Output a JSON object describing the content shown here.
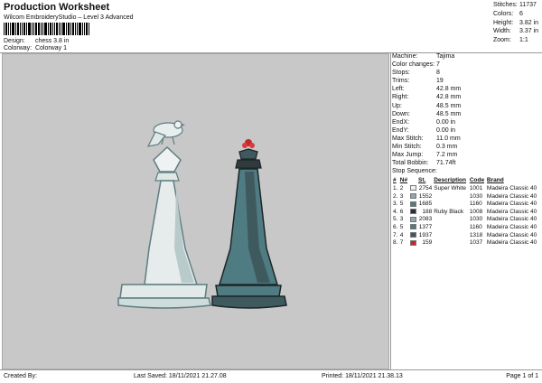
{
  "header": {
    "title": "Production Worksheet",
    "subtitle": "Wilcom EmbroideryStudio – Level 3 Advanced",
    "design_label": "Design:",
    "design_value": "chess 3.8 in",
    "colorway_label": "Colorway:",
    "colorway_value": "Colorway 1"
  },
  "summary": [
    {
      "label": "Stitches:",
      "value": "11737"
    },
    {
      "label": "Colors:",
      "value": "6"
    },
    {
      "label": "Height:",
      "value": "3.82 in"
    },
    {
      "label": "Width:",
      "value": "3.37 in"
    },
    {
      "label": "Zoom:",
      "value": "1:1"
    }
  ],
  "machine": [
    {
      "label": "Machine:",
      "value": "Tajima"
    },
    {
      "label": "Color changes:",
      "value": "7"
    },
    {
      "label": "Stops:",
      "value": "8"
    },
    {
      "label": "Trims:",
      "value": "19"
    },
    {
      "label": "Left:",
      "value": "42.8 mm"
    },
    {
      "label": "Right:",
      "value": "42.8 mm"
    },
    {
      "label": "Up:",
      "value": "48.5 mm"
    },
    {
      "label": "Down:",
      "value": "48.5 mm"
    },
    {
      "label": "EndX:",
      "value": "0.00 in"
    },
    {
      "label": "EndY:",
      "value": "0.00 in"
    },
    {
      "label": "Max Stitch:",
      "value": "11.0 mm"
    },
    {
      "label": "Min Stitch:",
      "value": "0.3 mm"
    },
    {
      "label": "Max Jump:",
      "value": "7.2 mm"
    },
    {
      "label": "Total Bobbin:",
      "value": "71.74ft"
    }
  ],
  "stop_sequence": {
    "title": "Stop Sequence:",
    "headers": [
      "#",
      "N#",
      "St.",
      "Description",
      "Code",
      "Brand"
    ],
    "rows": [
      {
        "num": "1.",
        "n": "2",
        "color": "#eef1f1",
        "st": "2754",
        "desc": "Super White",
        "code": "1001",
        "brand": "Madeira Classic 40"
      },
      {
        "num": "2.",
        "n": "3",
        "color": "#8fa9aa",
        "st": "1552",
        "desc": "",
        "code": "1030",
        "brand": "Madeira Classic 40"
      },
      {
        "num": "3.",
        "n": "5",
        "color": "#4f7b82",
        "st": "1685",
        "desc": "",
        "code": "1160",
        "brand": "Madeira Classic 40"
      },
      {
        "num": "4.",
        "n": "6",
        "color": "#2a2f31",
        "st": "188",
        "desc": "Ruby Black",
        "code": "1008",
        "brand": "Madeira Classic 40"
      },
      {
        "num": "5.",
        "n": "3",
        "color": "#8fa9aa",
        "st": "2083",
        "desc": "",
        "code": "1030",
        "brand": "Madeira Classic 40"
      },
      {
        "num": "6.",
        "n": "5",
        "color": "#4f7b82",
        "st": "1377",
        "desc": "",
        "code": "1160",
        "brand": "Madeira Classic 40"
      },
      {
        "num": "7.",
        "n": "4",
        "color": "#3f5a5e",
        "st": "1937",
        "desc": "",
        "code": "1318",
        "brand": "Madeira Classic 40"
      },
      {
        "num": "8.",
        "n": "7",
        "color": "#c8262b",
        "st": "159",
        "desc": "",
        "code": "1037",
        "brand": "Madeira Classic 40"
      }
    ]
  },
  "footer": {
    "created_by": "Created By:",
    "last_saved": "Last Saved: 18/11/2021 21.27.08",
    "printed": "Printed: 18/11/2021 21.38.13",
    "page": "Page 1 of 1"
  }
}
